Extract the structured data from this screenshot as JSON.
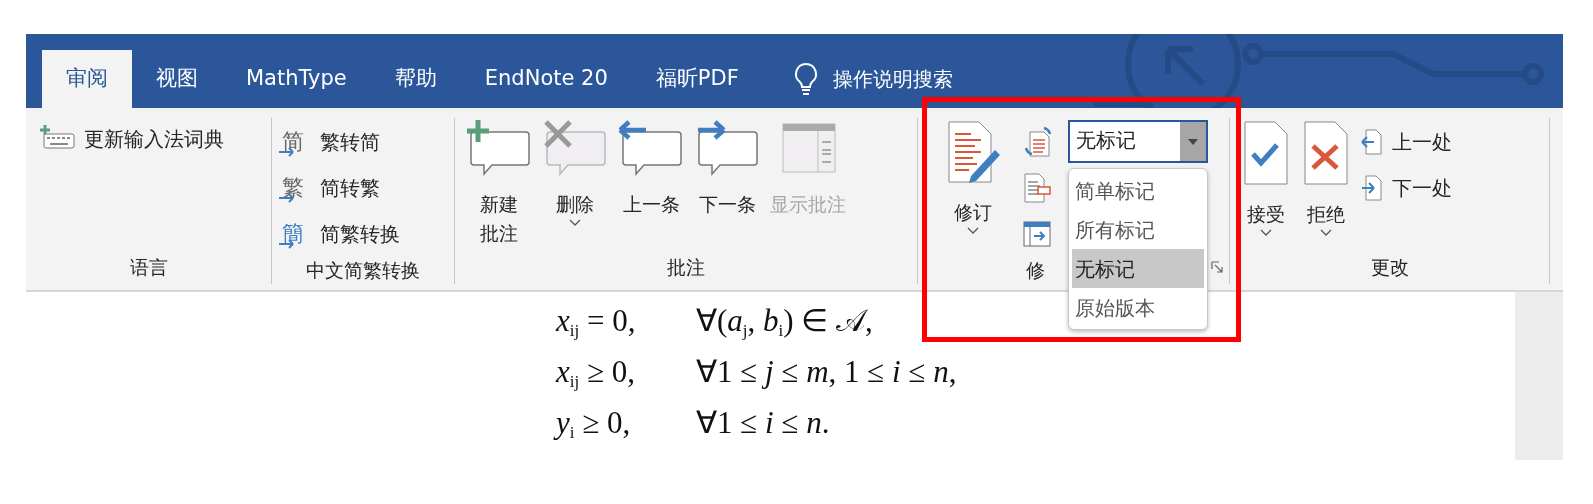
{
  "tabs": [
    {
      "label": "审阅",
      "selected": true
    },
    {
      "label": "视图",
      "selected": false
    },
    {
      "label": "MathType",
      "selected": false
    },
    {
      "label": "帮助",
      "selected": false
    },
    {
      "label": "EndNote 20",
      "selected": false
    },
    {
      "label": "福昕PDF",
      "selected": false
    }
  ],
  "tell_me": {
    "label": "操作说明搜索"
  },
  "groups": [
    {
      "label": "语言",
      "items": [
        {
          "kind": "small",
          "label": "更新输入法词典"
        }
      ]
    },
    {
      "label": "中文简繁转换",
      "items": [
        {
          "kind": "glyph",
          "glyph": "简",
          "label": "繁转简"
        },
        {
          "kind": "glyph",
          "glyph": "繁",
          "label": "简转繁"
        },
        {
          "kind": "glyph",
          "glyph": "簡",
          "label": "简繁转换"
        }
      ]
    },
    {
      "label": "批注",
      "items": [
        {
          "kind": "large",
          "label": "新建批注",
          "dropdown": false,
          "disabled": false
        },
        {
          "kind": "large",
          "label": "删除",
          "dropdown": true,
          "disabled": false
        },
        {
          "kind": "large",
          "label": "上一条",
          "dropdown": false,
          "disabled": false
        },
        {
          "kind": "large",
          "label": "下一条",
          "dropdown": false,
          "disabled": false
        },
        {
          "kind": "large",
          "label": "显示批注",
          "dropdown": false,
          "disabled": true
        }
      ]
    },
    {
      "label": "修",
      "dialog_launcher": true,
      "items": [
        {
          "kind": "large",
          "label": "修订",
          "dropdown": true,
          "disabled": false
        },
        {
          "kind": "icon"
        },
        {
          "kind": "icon"
        },
        {
          "kind": "icon"
        },
        {
          "kind": "combo",
          "value": "无标记",
          "open": true,
          "options": [
            {
              "label": "简单标记",
              "selected": false
            },
            {
              "label": "所有标记",
              "selected": false
            },
            {
              "label": "无标记",
              "selected": true
            },
            {
              "label": "原始版本",
              "selected": false
            }
          ]
        }
      ]
    },
    {
      "label": "更改",
      "items": [
        {
          "kind": "large",
          "label": "接受",
          "dropdown": true,
          "disabled": false
        },
        {
          "kind": "large",
          "label": "拒绝",
          "dropdown": true,
          "disabled": false
        },
        {
          "kind": "small",
          "label": "上一处"
        },
        {
          "kind": "small",
          "label": "下一处"
        }
      ]
    }
  ],
  "document": {
    "lines": [
      {
        "lhs": "*x*$_{ij}$ = 0,",
        "rhs": "∀(*a*$_{j}$, *b*$_{i}$) ∈ 𝒜,"
      },
      {
        "lhs": "*x*$_{ij}$ ≥ 0,",
        "rhs": "∀1 ≤ *j* ≤ *m*, 1 ≤ *i* ≤ *n*,"
      },
      {
        "lhs": "*y*$_{i}$ ≥ 0,",
        "rhs": "∀1 ≤ *i* ≤ *n*."
      }
    ]
  },
  "annotation": {
    "kind": "highlight"
  }
}
